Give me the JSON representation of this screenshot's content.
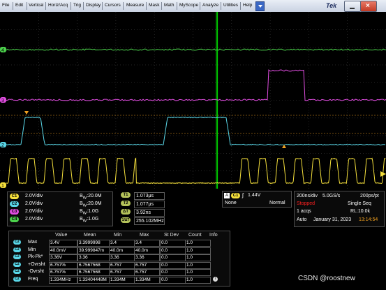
{
  "menu": {
    "items": [
      "File",
      "Edit",
      "Vertical",
      "Horiz/Acq",
      "Trig",
      "Display",
      "Cursors",
      "Measure",
      "Mask",
      "Math",
      "MyScope",
      "Analyze",
      "Utilities",
      "Help"
    ],
    "logo": "Tek"
  },
  "channels": [
    {
      "tag": "C1",
      "color": "#f5e03c",
      "scale": "2.0V/div",
      "bw": "20.0M"
    },
    {
      "tag": "C2",
      "color": "#5ad7e8",
      "scale": "2.0V/div",
      "bw": "20.0M"
    },
    {
      "tag": "C3",
      "color": "#e04de0",
      "scale": "2.0V/div",
      "bw": "1.0G"
    },
    {
      "tag": "C4",
      "color": "#4cd24c",
      "scale": "2.0V/div",
      "bw": "1.0G"
    }
  ],
  "channel_bw_prefix": "B",
  "channel_bw_sub": "W",
  "measurements": [
    {
      "tag": "T1",
      "value": "1.073μs"
    },
    {
      "tag": "T2",
      "value": "1.077μs"
    },
    {
      "tag": "ΔT",
      "value": "3.92ns"
    },
    {
      "tag": "1/ΔT",
      "value": "255.102MHz"
    }
  ],
  "trigger": {
    "source": "C1",
    "slope_symbol": "ʃ",
    "level": "1.44V",
    "coupling": "None",
    "mode": "Normal"
  },
  "acquisition": {
    "timebase": "200ns/div",
    "sample_rate": "5.0GS/s",
    "resolution": "200ps/pt",
    "state": "Stopped",
    "seq": "Single Seq",
    "acqs": "1 acqs",
    "record_length": "RL:10.0k",
    "auto": "Auto",
    "date": "January 31, 2023",
    "time": "13:14:54"
  },
  "stats": {
    "headers": [
      "Value",
      "Mean",
      "Min",
      "Max",
      "St Dev",
      "Count",
      "Info"
    ],
    "rows": [
      {
        "tag": "C2",
        "name": "Max",
        "cells": [
          "3.4V",
          "3.3999998",
          "3.4",
          "3.4",
          "0.0",
          "1.0",
          ""
        ]
      },
      {
        "tag": "C2",
        "name": "Min",
        "cells": [
          "40.0mV",
          "39.999847m",
          "40.0m",
          "40.0m",
          "0.0",
          "1.0",
          ""
        ]
      },
      {
        "tag": "C2",
        "name": "Pk-Pk*",
        "cells": [
          "3.36V",
          "3.36",
          "3.36",
          "3.36",
          "0.0",
          "1.0",
          ""
        ]
      },
      {
        "tag": "C2",
        "name": "+Ovrsht",
        "cells": [
          "6.757%",
          "6.7567568",
          "6.757",
          "6.757",
          "0.0",
          "1.0",
          ""
        ]
      },
      {
        "tag": "C2",
        "name": "-Ovrsht",
        "cells": [
          "6.757%",
          "6.7567568",
          "6.757",
          "6.757",
          "0.0",
          "1.0",
          ""
        ]
      },
      {
        "tag": "C2",
        "name": "Freq",
        "cells": [
          "1.334MHz",
          "1.33404448M",
          "1.334M",
          "1.334M",
          "0.0",
          "1.0",
          ""
        ]
      }
    ]
  },
  "markers": {
    "ch4": "4",
    "ch3": "3",
    "ch2": "2",
    "ch1": "1"
  },
  "watermark": "CSDN @roostnew",
  "colors": {
    "ch1": "#f5e03c",
    "ch2": "#5ad7e8",
    "ch3": "#e04de0",
    "ch4": "#4cd24c",
    "cursor": "#00c800",
    "trigger": "#f0a020"
  }
}
